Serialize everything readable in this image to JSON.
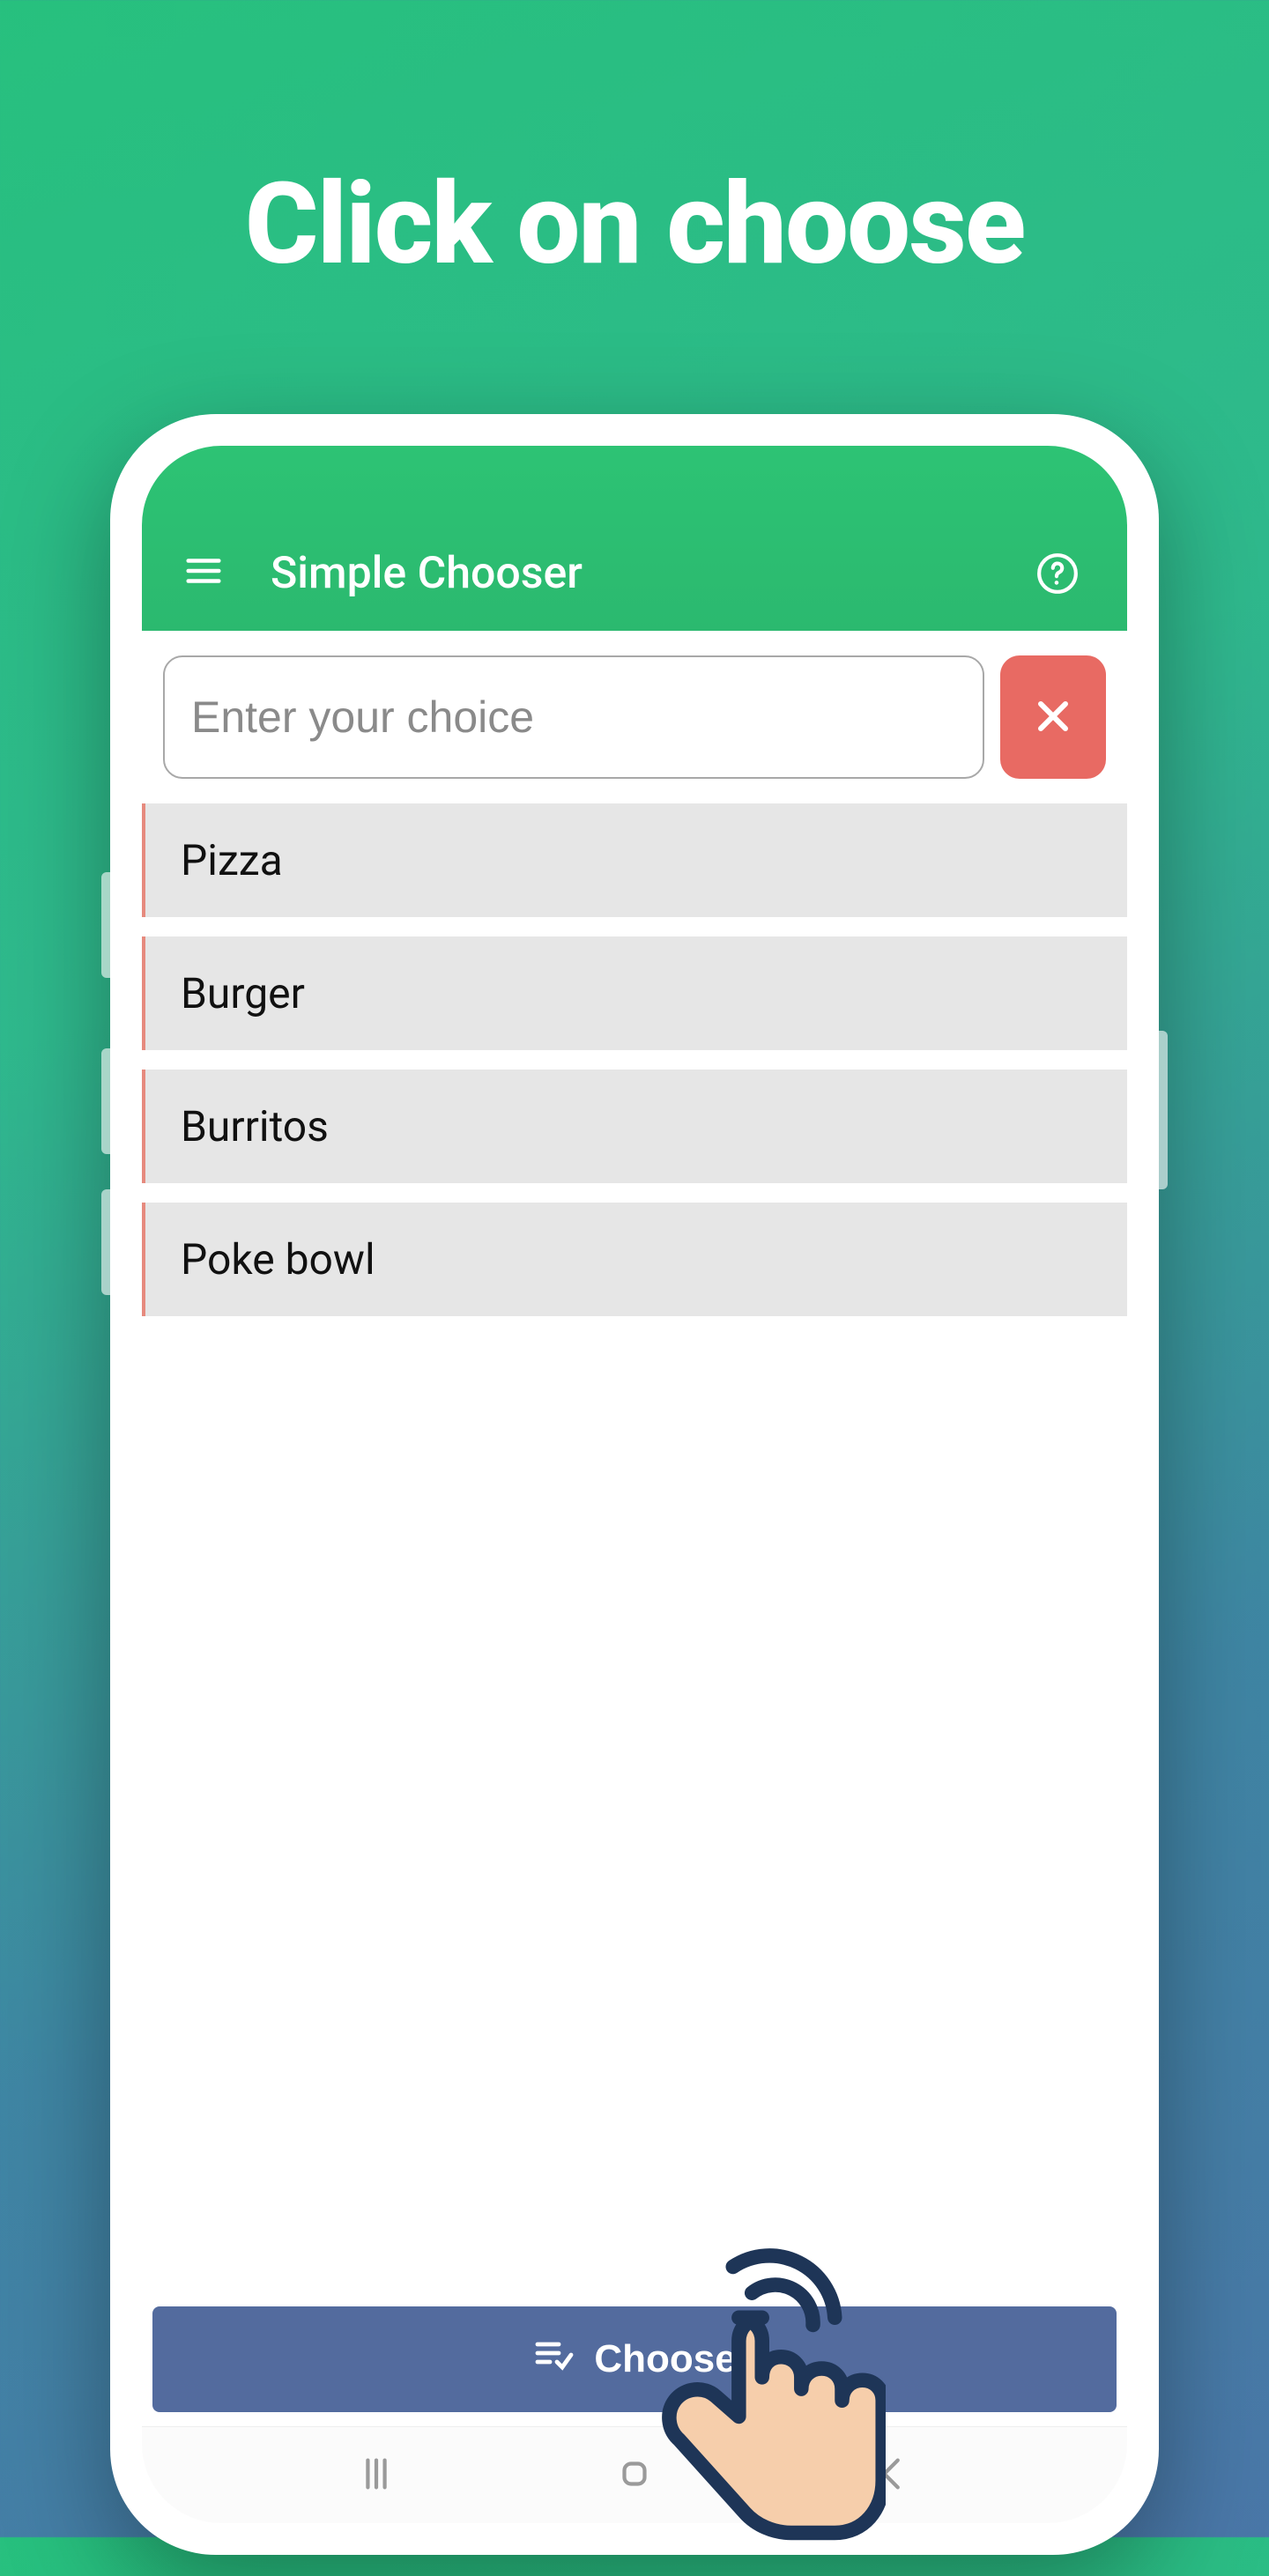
{
  "headline": "Click on choose",
  "appbar": {
    "title": "Simple Chooser"
  },
  "input": {
    "placeholder": "Enter your choice",
    "value": ""
  },
  "items": [
    "Pizza",
    "Burger",
    "Burritos",
    "Poke bowl"
  ],
  "choose_label": "Choose",
  "colors": {
    "accent_green": "#2bb96f",
    "danger": "#e86a63",
    "primary_button": "#536b9e"
  }
}
